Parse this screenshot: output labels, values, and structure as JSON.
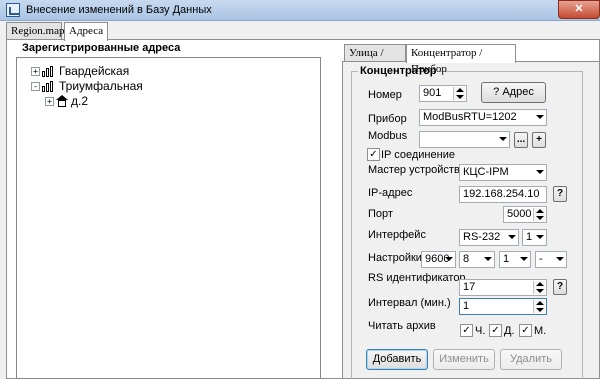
{
  "window": {
    "title": "Внесение изменений в Базу Данных"
  },
  "outer_tabs": [
    {
      "label": "Region.map"
    },
    {
      "label": "Адреса"
    }
  ],
  "address_panel": {
    "group_title": "Зарегистрированные адреса",
    "tree": [
      {
        "label": "Гвардейская",
        "expander": "+"
      },
      {
        "label": "Триумфальная",
        "expander": "-"
      },
      {
        "label": "д.2",
        "expander": "+"
      }
    ]
  },
  "inner_tabs": [
    {
      "label": "Улица / Дом"
    },
    {
      "label": "Концентратор / Прибор"
    }
  ],
  "concentrator": {
    "group_title": "Концентратор",
    "number": {
      "label": "Номер",
      "value": "901"
    },
    "address_button": "? Адрес",
    "device": {
      "label": "Прибор",
      "value": "ModBusRTU=1202"
    },
    "modbus": {
      "label": "Modbus",
      "value": "",
      "more_button": "...",
      "add_button": "+"
    },
    "ip_connection": {
      "label": "IP соединение",
      "checked": true
    },
    "master": {
      "label": "Мастер устройство",
      "value": "КЦС-IPM"
    },
    "ip_address": {
      "label": "IP-адрес",
      "value": "192.168.254.10",
      "help": "?"
    },
    "port": {
      "label": "Порт",
      "value": "5000"
    },
    "interface": {
      "label": "Интерфейс",
      "value": "RS-232",
      "index": "1"
    },
    "settings": {
      "label": "Настройки",
      "baud": "9600",
      "bits": "8",
      "stop": "1",
      "parity": "-"
    },
    "rs_id": {
      "label": "RS идентификатор",
      "value": "17",
      "help": "?"
    },
    "interval": {
      "label": "Интервал (мин.)",
      "value": "1"
    },
    "read_archive": {
      "label": "Читать архив",
      "options": [
        {
          "label": "Ч.",
          "checked": true
        },
        {
          "label": "Д.",
          "checked": true
        },
        {
          "label": "М.",
          "checked": true
        }
      ]
    },
    "buttons": {
      "add": "Добавить",
      "edit": "Изменить",
      "delete": "Удалить"
    }
  }
}
